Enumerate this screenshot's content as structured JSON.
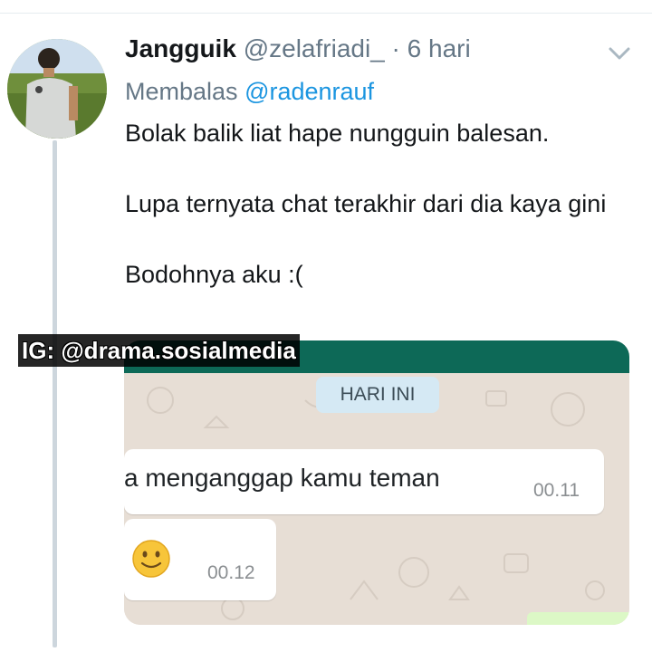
{
  "tweet": {
    "display_name": "Jangguik",
    "handle": "@zelafriadi_",
    "separator": "·",
    "time_ago": "6 hari",
    "reply_prefix": "Membalas",
    "reply_to": "@radenrauf",
    "lines": [
      "Bolak balik liat hape nungguin balesan.",
      "Lupa ternyata chat terakhir dari dia kaya gini",
      "Bodohnya aku :("
    ],
    "colors": {
      "link": "#1b95e0",
      "muted": "#657786",
      "text": "#14171a",
      "thread_line": "#cdd6dd"
    }
  },
  "chat_screenshot": {
    "date_chip": "HARI INI",
    "messages": [
      {
        "text": "a menganggap kamu teman",
        "time": "00.11"
      },
      {
        "emoji": "slightly-smiling-face",
        "time": "00.12"
      }
    ],
    "colors": {
      "header": "#0d6957",
      "background": "#e7ded5",
      "date_chip": "#d5e9f4"
    }
  },
  "watermark": {
    "text": "IG: @drama.sosialmedia"
  },
  "icons": {
    "menu": "chevron-down-icon",
    "avatar": "user-avatar"
  }
}
